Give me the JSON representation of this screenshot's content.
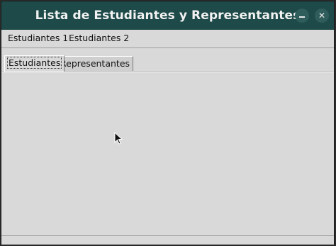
{
  "window": {
    "title": "Lista de Estudiantes y Representantes"
  },
  "menubar": {
    "items": [
      {
        "label": "Estudiantes 1"
      },
      {
        "label": "Estudiantes 2"
      }
    ]
  },
  "tabs": [
    {
      "label": "Estudiantes",
      "active": true
    },
    {
      "label": "Representantes",
      "active": false
    }
  ],
  "icons": {
    "minimize": "minimize-icon",
    "close": "close-icon",
    "cursor": "mouse-pointer-icon"
  },
  "colors": {
    "titlebar": "#1e4a49",
    "window_bg": "#d9d9d9"
  }
}
